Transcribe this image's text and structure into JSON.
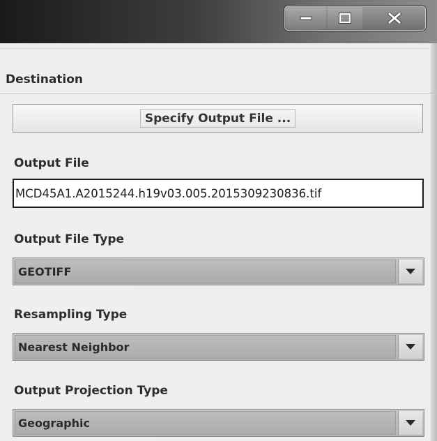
{
  "window": {
    "minimize_icon": "minimize-icon",
    "maximize_icon": "maximize-icon",
    "close_icon": "close-icon"
  },
  "destination": {
    "section_title": "Destination",
    "specify_button_label": "Specify Output File ...",
    "output_file_label": "Output File",
    "output_file_value": "MCD45A1.A2015244.h19v03.005.2015309230836.tif",
    "output_file_type_label": "Output File Type",
    "output_file_type_value": "GEOTIFF",
    "resampling_type_label": "Resampling Type",
    "resampling_type_value": "Nearest Neighbor",
    "projection_type_label": "Output Projection Type",
    "projection_type_value": "Geographic"
  }
}
